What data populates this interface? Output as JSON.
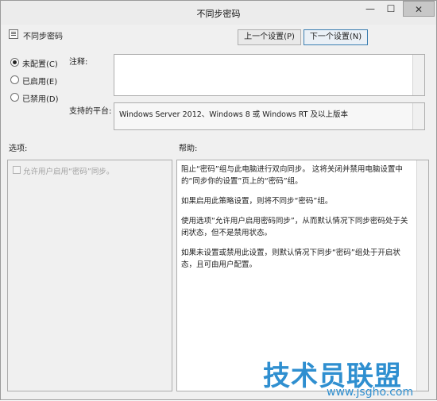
{
  "window": {
    "title": "不同步密码",
    "controls": {
      "minimize": "—",
      "maximize": "☐",
      "close": "✕"
    }
  },
  "policy_name": "不同步密码",
  "nav": {
    "prev": "上一个设置(P)",
    "next": "下一个设置(N)"
  },
  "radios": [
    {
      "label": "未配置(C)",
      "selected": true
    },
    {
      "label": "已启用(E)",
      "selected": false
    },
    {
      "label": "已禁用(D)",
      "selected": false
    }
  ],
  "labels": {
    "comment": "注释:",
    "platform": "支持的平台:",
    "options": "选项:",
    "help": "帮助:"
  },
  "platform_text": "Windows Server 2012、Windows 8 或 Windows RT 及以上版本",
  "option_checkbox": "允许用户启用“密码”同步。",
  "help_paragraphs": [
    "阻止“密码”组与此电脑进行双向同步。 这将关闭并禁用电脑设置中的“同步你的设置”页上的“密码”组。",
    "如果启用此策略设置，则将不同步“密码”组。",
    "使用选项“允许用户启用密码同步”，从而默认情况下同步密码处于关闭状态，但不是禁用状态。",
    "如果未设置或禁用此设置，则默认情况下同步“密码”组处于开启状态，且可由用户配置。"
  ],
  "watermark": {
    "line1": "技术员联盟",
    "line2": "www.jsgho.com"
  }
}
